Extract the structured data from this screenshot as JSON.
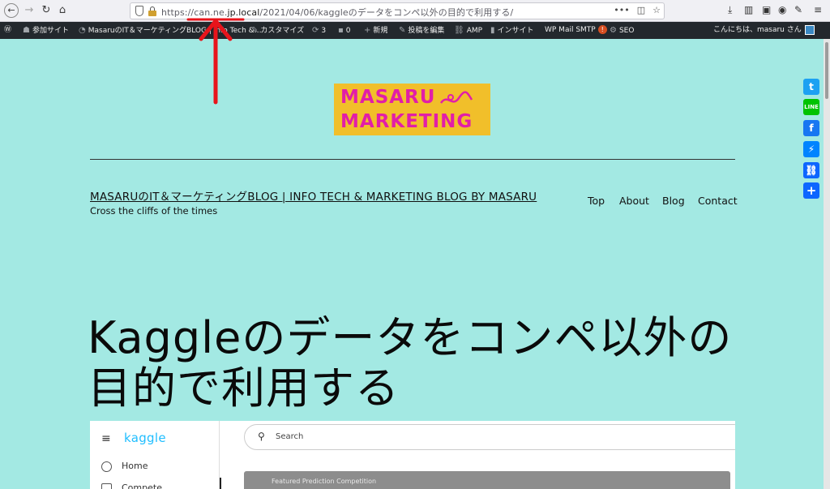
{
  "browser": {
    "url_prefix": "https://",
    "url_dom1": "can.ne.",
    "url_dom2": "jp.local",
    "url_path": "/2021/04/06/kaggleのデータをコンペ以外の目的で利用する/",
    "more": "•••"
  },
  "adminbar": {
    "sanka": "参加サイト",
    "site": "MasaruのIT＆マーケティングBLOG | Info Tech &…",
    "customize": "カスタマイズ",
    "updates": "3",
    "comments": "0",
    "new": "新規",
    "edit": "投稿を編集",
    "amp": "AMP",
    "insight": "インサイト",
    "smtp": "WP Mail SMTP",
    "smtp_badge": "!",
    "seo": "SEO",
    "greeting": "こんにちは、masaru さん"
  },
  "logo": {
    "line1": "MASARU",
    "line2": "MARKETING"
  },
  "site": {
    "title": "MASARUのIT＆マーケティングBLOG | INFO TECH & MARKETING BLOG BY MASARU",
    "tagline": "Cross the cliffs of the times"
  },
  "menu": [
    "Top",
    "About",
    "Blog",
    "Contact"
  ],
  "post": {
    "title": "Kaggleのデータをコンペ以外の目的で利用する"
  },
  "kaggle": {
    "logo": "kaggle",
    "home": "Home",
    "compete": "Compete",
    "search_placeholder": "Search",
    "card_label": "Featured Prediction Competition"
  },
  "colors": {
    "page_bg": "#a3e9e3",
    "accent_red": "#e8141b",
    "logo_bg": "#f1bf2a",
    "logo_text": "#e21ea8"
  }
}
